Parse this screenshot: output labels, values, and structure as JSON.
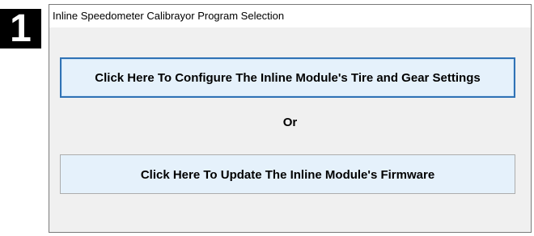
{
  "step_badge": "1",
  "window": {
    "title": "Inline Speedometer Calibrayor Program Selection"
  },
  "buttons": {
    "configure_label": "Click Here To Configure The Inline Module's Tire and Gear Settings",
    "firmware_label": "Click Here To Update The Inline Module's Firmware"
  },
  "separator_text": "Or",
  "colors": {
    "button_background": "#e5f1fb",
    "focused_button_border": "#2f72b5",
    "window_background": "#f0f0f0"
  }
}
